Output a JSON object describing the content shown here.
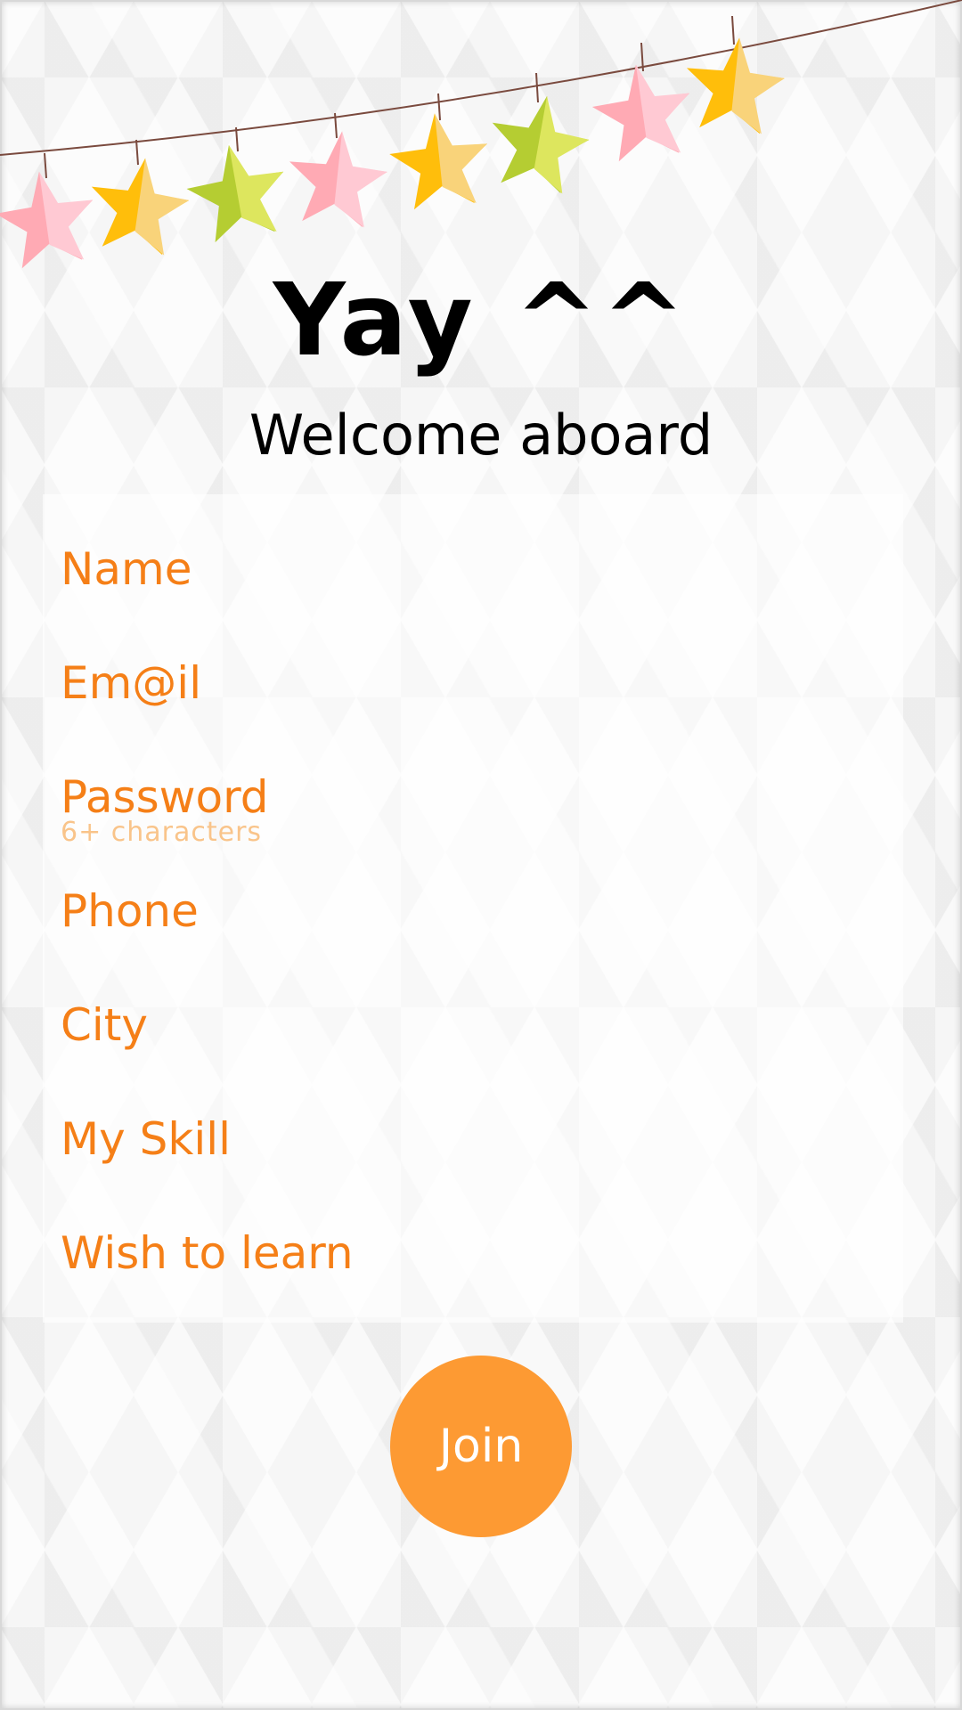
{
  "header": {
    "title": "Yay ^^",
    "subtitle": "Welcome aboard"
  },
  "form": {
    "fields": [
      {
        "label": "Name",
        "hint": ""
      },
      {
        "label": "Em@il",
        "hint": ""
      },
      {
        "label": "Password",
        "hint": "6+ characters"
      },
      {
        "label": "Phone",
        "hint": ""
      },
      {
        "label": "City",
        "hint": ""
      },
      {
        "label": "My Skill",
        "hint": ""
      },
      {
        "label": "Wish to learn",
        "hint": ""
      }
    ]
  },
  "join_button": {
    "label": "Join"
  },
  "colors": {
    "label_orange": "#f57f17",
    "hint_orange": "#f9c48a",
    "button_orange": "#fd9a33",
    "star_pink": "#ffaab4",
    "star_yellow": "#ffbe0b",
    "star_green": "#b5cd32",
    "string_brown": "#7a4a3e"
  },
  "decorations": {
    "bunting_icons": [
      "star-pink",
      "star-yellow",
      "star-green",
      "star-pink",
      "star-yellow",
      "star-green",
      "star-pink",
      "star-yellow"
    ]
  }
}
